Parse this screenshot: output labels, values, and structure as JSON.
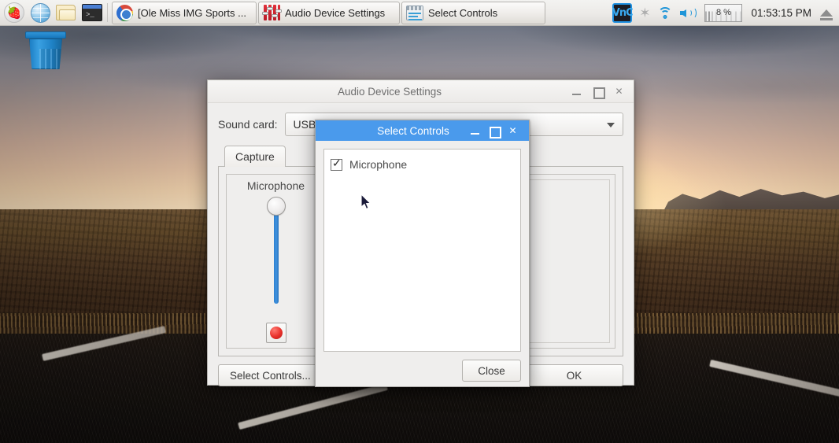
{
  "taskbar": {
    "launchers": [
      {
        "name": "raspberry-menu",
        "icon": "raspberry-icon",
        "glyph": "🍓"
      },
      {
        "name": "web-browser",
        "icon": "globe-icon"
      },
      {
        "name": "file-manager",
        "icon": "folder-icon"
      },
      {
        "name": "terminal",
        "icon": "terminal-icon",
        "prompt": ">_"
      }
    ],
    "windows": [
      {
        "label": "[Ole Miss IMG Sports ...",
        "icon": "chromium-icon"
      },
      {
        "label": "Audio Device Settings",
        "icon": "audio-mixer-icon"
      },
      {
        "label": "Select Controls",
        "icon": "sliders-icon"
      }
    ],
    "tray": {
      "vnc_label": "VnC",
      "bluetooth_glyph": "✶",
      "cpu_usage": "8 %",
      "clock": "01:53:15 PM"
    }
  },
  "desktop": {
    "icons": [
      {
        "name": "trash",
        "label": "Trash"
      }
    ]
  },
  "audio_dialog": {
    "title": "Audio Device Settings",
    "sound_card_label": "Sound card:",
    "sound_card_value": "USB PnP Audio Device (Alsa mixer)",
    "tabs": [
      {
        "label": "Capture",
        "active": true
      }
    ],
    "controls": [
      {
        "name": "Microphone",
        "slider_value": 100,
        "record_enabled": true
      }
    ],
    "buttons": {
      "select_controls": "Select Controls...",
      "ok": "OK"
    },
    "titlebar_buttons": {
      "minimize": "–",
      "maximize": "□",
      "close": "✕"
    }
  },
  "select_dialog": {
    "title": "Select Controls",
    "items": [
      {
        "label": "Microphone",
        "checked": true
      }
    ],
    "buttons": {
      "close": "Close"
    },
    "titlebar_buttons": {
      "minimize": "–",
      "maximize": "□",
      "close": "✕"
    }
  },
  "colors": {
    "accent_blue": "#4a9aec",
    "slider_blue": "#3f92de",
    "record_red": "#e8302a",
    "tray_icon_blue": "#2196d8"
  }
}
